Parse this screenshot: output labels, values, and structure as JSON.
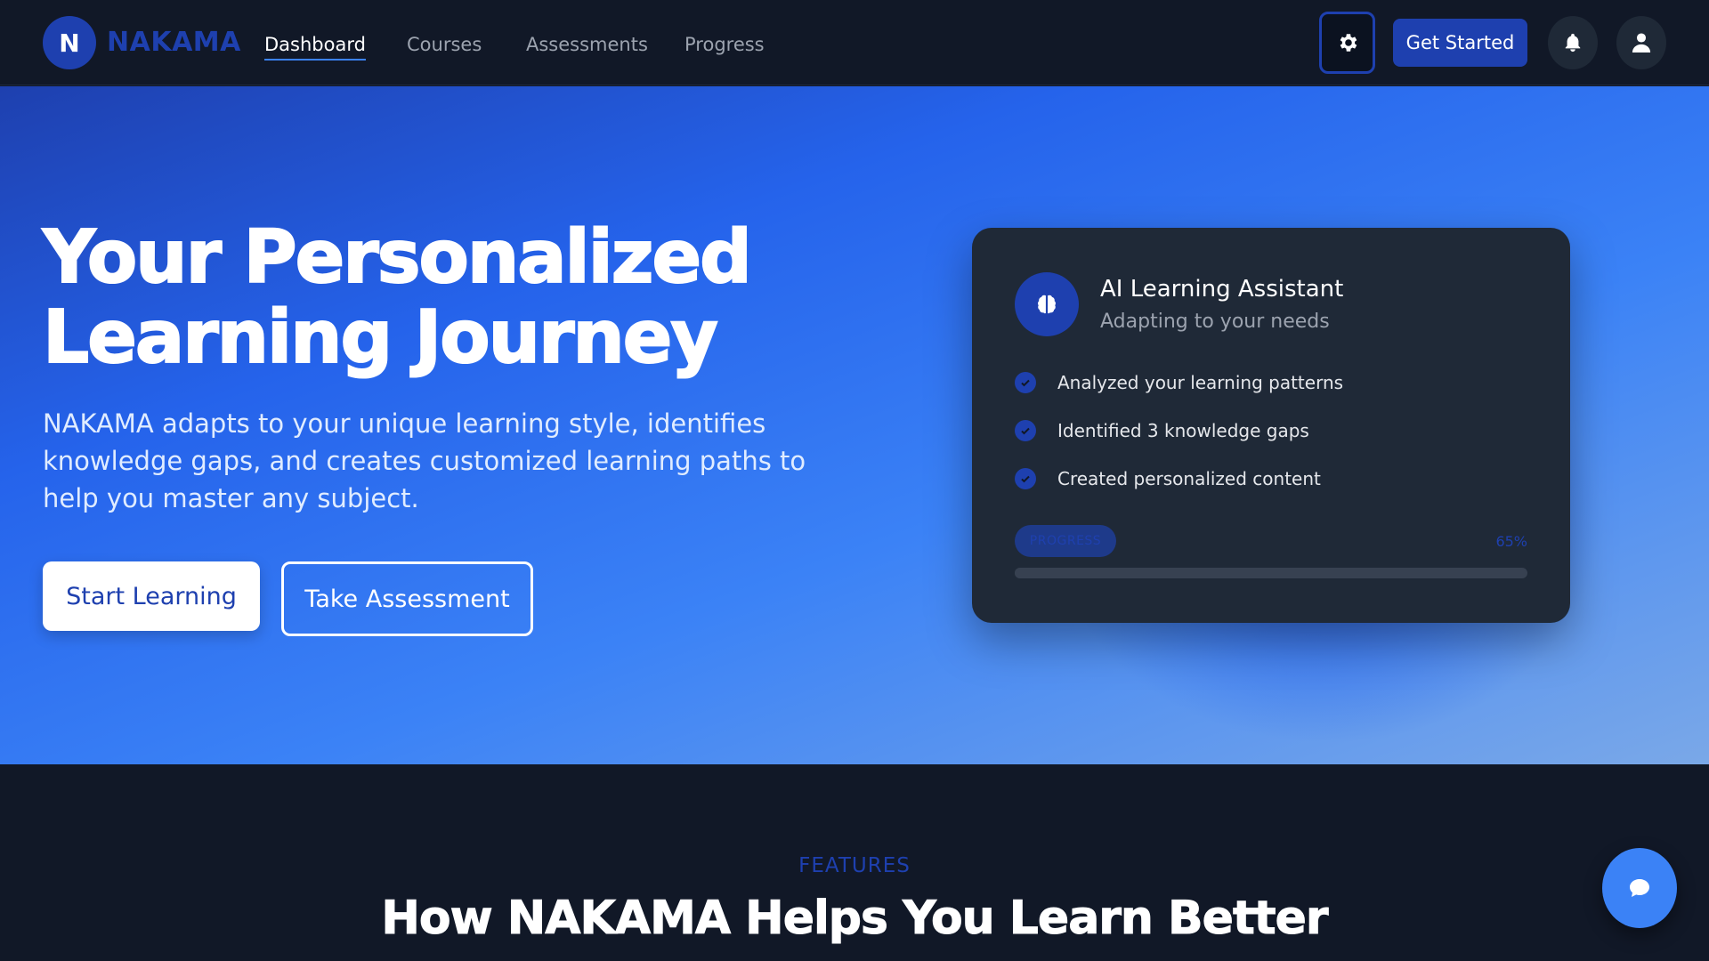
{
  "nav": {
    "logo_letter": "N",
    "brand": "NAKAMA",
    "links": [
      "Dashboard",
      "Courses",
      "Assessments",
      "Progress"
    ],
    "active_link": "Dashboard",
    "get_started_label": "Get Started"
  },
  "hero": {
    "title_line1": "Your Personalized",
    "title_line2": "Learning Journey",
    "subtitle": "NAKAMA adapts to your unique learning style, identifies knowledge gaps, and creates customized learning paths to help you master any subject.",
    "start_button": "Start Learning",
    "assess_button": "Take Assessment"
  },
  "ai_card": {
    "title": "AI Learning Assistant",
    "subtitle": "Adapting to your needs",
    "items": [
      "Analyzed your learning patterns",
      "Identified 3 knowledge gaps",
      "Created personalized content"
    ],
    "progress_label": "PROGRESS",
    "progress_text": "65%",
    "progress_fraction": 0.65
  },
  "features": {
    "eyebrow": "FEATURES",
    "title": "How NAKAMA Helps You Learn Better"
  },
  "colors": {
    "primary": "#1e40af",
    "accent": "#3b82f6",
    "background": "#111827",
    "card": "#1f2937"
  },
  "icons": {
    "settings": "gear-icon",
    "notifications": "bell-icon",
    "profile": "user-icon",
    "assistant": "brain-icon",
    "check": "check-icon",
    "chat": "chat-bubble-icon"
  }
}
